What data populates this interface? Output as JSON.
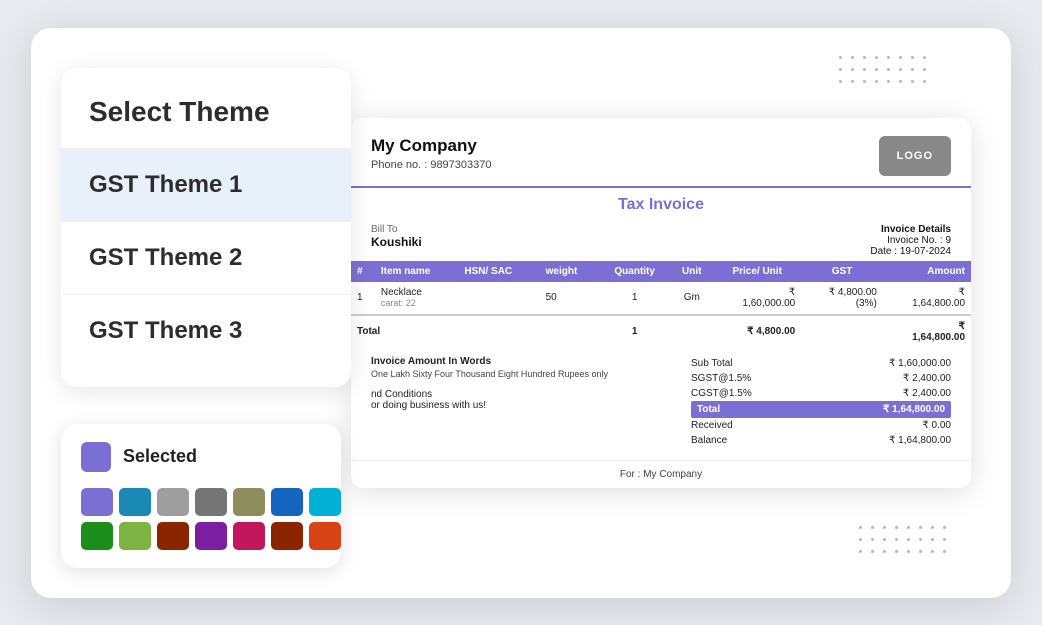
{
  "background": "#e8eaf0",
  "theme_panel": {
    "title": "Select Theme",
    "items": [
      {
        "label": "GST Theme 1",
        "active": true
      },
      {
        "label": "GST Theme 2",
        "active": false
      },
      {
        "label": "GST Theme 3",
        "active": false
      }
    ]
  },
  "invoice": {
    "company_name": "My Company",
    "company_phone": "Phone no. : 9897303370",
    "logo_text": "LOGO",
    "title": "Tax Invoice",
    "bill_to_label": "Bill To",
    "bill_to_name": "Koushiki",
    "invoice_details_label": "Invoice Details",
    "invoice_no": "Invoice No. : 9",
    "invoice_date": "Date : 19-07-2024",
    "table_headers": [
      "#",
      "Item name",
      "HSN/ SAC",
      "weight",
      "Quantity",
      "Unit",
      "Price/ Unit",
      "GST",
      "Amount"
    ],
    "table_rows": [
      {
        "num": "1",
        "item": "Necklace",
        "sub": "carat: 22",
        "hsn": "",
        "weight": "50",
        "qty": "1",
        "unit": "Gm",
        "price": "₹ 1,60,000.00",
        "gst": "₹ 4,800.00\n(3%)",
        "amount": "₹ 1,64,800.00"
      }
    ],
    "total_row": {
      "label": "Total",
      "qty": "1",
      "price": "₹ 4,800.00",
      "amount": "₹ 1,64,800.00"
    },
    "amount_words_title": "Invoice Amount In Words",
    "amount_words": "One Lakh Sixty Four Thousand Eight Hundred Rupees only",
    "sub_total_label": "Sub Total",
    "sub_total_value": "₹ 1,60,000.00",
    "sgst_label": "SGST@1.5%",
    "sgst_value": "₹ 2,400.00",
    "cgst_label": "CGST@1.5%",
    "cgst_value": "₹ 2,400.00",
    "total_label": "Total",
    "total_value": "₹ 1,64,800.00",
    "received_label": "Received",
    "received_value": "₹ 0.00",
    "balance_label": "Balance",
    "balance_value": "₹ 1,64,800.00",
    "terms_title": "nd Conditions",
    "terms_text": "or doing business with us!",
    "footer_text": "For : My Company"
  },
  "color_panel": {
    "selected_label": "Selected",
    "selected_color": "#7c6fd4",
    "colors_row1": [
      "#7c6fd4",
      "#1a8ab5",
      "#9e9e9e",
      "#757575",
      "#8d8d5e",
      "#1565c0",
      "#00b0d6"
    ],
    "colors_row2": [
      "#1b8e1b",
      "#7cb342",
      "#8b2500",
      "#7b1fa2",
      "#c2185b",
      "#8b2500",
      "#d84315"
    ]
  }
}
